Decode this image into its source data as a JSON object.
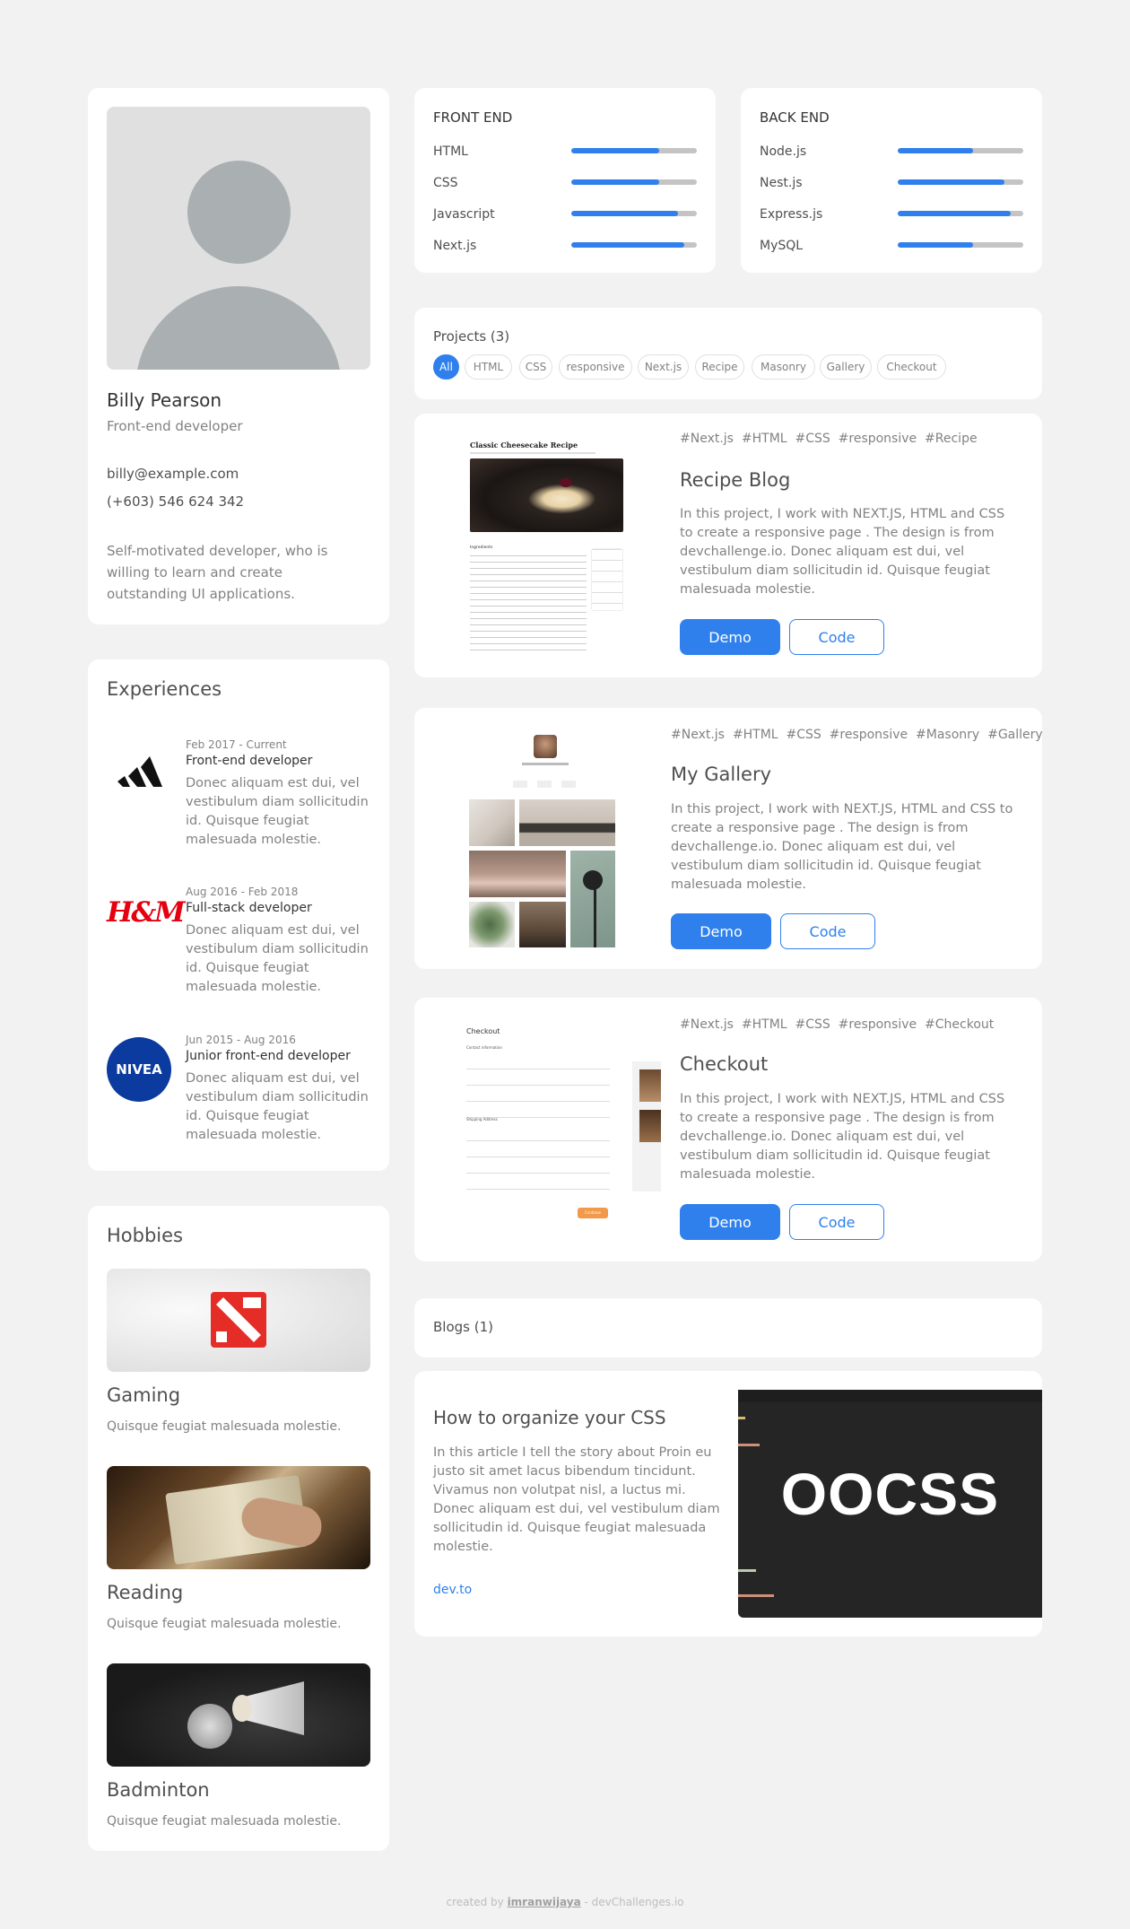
{
  "profile": {
    "name": "Billy Pearson",
    "title": "Front-end developer",
    "email": "billy@example.com",
    "phone": "(+603) 546 624 342",
    "bio": "Self-motivated developer, who is willing to learn and create outstanding UI applications."
  },
  "skills": {
    "front": {
      "heading": "FRONT END",
      "items": [
        {
          "name": "HTML",
          "level": 0.7
        },
        {
          "name": "CSS",
          "level": 0.7
        },
        {
          "name": "Javascript",
          "level": 0.85
        },
        {
          "name": "Next.js",
          "level": 0.9
        }
      ]
    },
    "back": {
      "heading": "BACK END",
      "items": [
        {
          "name": "Node.js",
          "level": 0.6
        },
        {
          "name": "Nest.js",
          "level": 0.85
        },
        {
          "name": "Express.js",
          "level": 0.9
        },
        {
          "name": "MySQL",
          "level": 0.6
        }
      ]
    }
  },
  "projects_header": {
    "title": "Projects (3)",
    "filters": [
      "All",
      "HTML",
      "CSS",
      "responsive",
      "Next.js",
      "Recipe",
      "Masonry",
      "Gallery",
      "Checkout"
    ],
    "active": "All"
  },
  "projects": [
    {
      "tags": "#Next.js  #HTML  #CSS  #responsive  #Recipe",
      "title": "Recipe Blog",
      "desc": "In this project, I work with NEXT.JS, HTML and CSS to create a responsive page . The design is from devchallenge.io. Donec aliquam est dui, vel vestibulum diam sollicitudin id. Quisque feugiat malesuada molestie.",
      "demo": "Demo",
      "code": "Code",
      "thumb_title": "Classic Cheesecake Recipe",
      "thumb_section": "Ingredients"
    },
    {
      "tags": "#Next.js  #HTML  #CSS  #responsive  #Masonry  #Gallery",
      "title": "My Gallery",
      "desc": "In this project, I work with NEXT.JS, HTML and CSS to create a responsive page . The design is from devchallenge.io. Donec aliquam est dui, vel vestibulum diam sollicitudin id. Quisque feugiat malesuada molestie.",
      "demo": "Demo",
      "code": "Code"
    },
    {
      "tags": "#Next.js  #HTML  #CSS  #responsive  #Checkout",
      "title": "Checkout",
      "desc": "In this project, I work with NEXT.JS, HTML and CSS to create a responsive page . The design is from devchallenge.io. Donec aliquam est dui, vel vestibulum diam sollicitudin id. Quisque feugiat malesuada molestie.",
      "demo": "Demo",
      "code": "Code",
      "thumb_title": "Checkout",
      "thumb_sections": [
        "Contact information",
        "Shipping Address"
      ],
      "thumb_button": "Continue"
    }
  ],
  "experiences": {
    "title": "Experiences",
    "items": [
      {
        "date": "Feb 2017 - Current",
        "role": "Front-end developer",
        "desc": "Donec aliquam est dui, vel vestibulum diam sollicitudin id. Quisque feugiat malesuada molestie.",
        "logo": "adidas-logo"
      },
      {
        "date": "Aug 2016 - Feb 2018",
        "role": "Full-stack developer",
        "desc": "Donec aliquam est dui, vel vestibulum diam sollicitudin id. Quisque feugiat malesuada molestie.",
        "logo": "hm-logo",
        "logo_text": "H&M"
      },
      {
        "date": "Jun 2015 - Aug 2016",
        "role": "Junior front-end developer",
        "desc": "Donec aliquam est dui, vel vestibulum diam sollicitudin id. Quisque feugiat malesuada molestie.",
        "logo": "nivea-logo",
        "logo_text": "NIVEA"
      }
    ]
  },
  "hobbies": {
    "title": "Hobbies",
    "items": [
      {
        "name": "Gaming",
        "desc": "Quisque feugiat malesuada molestie."
      },
      {
        "name": "Reading",
        "desc": "Quisque feugiat malesuada molestie."
      },
      {
        "name": "Badminton",
        "desc": "Quisque feugiat malesuada molestie."
      }
    ]
  },
  "blogs": {
    "header": "Blogs (1)",
    "post": {
      "title": "How to organize your CSS",
      "desc": "In this article I tell the story about Proin eu justo sit amet lacus bibendum tincidunt. Vivamus non volutpat nisl, a luctus mi. Donec aliquam est dui, vel vestibulum diam sollicitudin id. Quisque feugiat malesuada molestie.",
      "link": "dev.to",
      "image_text": "OOCSS"
    }
  },
  "footer": {
    "prefix": "created by ",
    "author": "imranwijaya",
    "suffix": " - devChallenges.io"
  },
  "colors": {
    "accent": "#2f80ed",
    "background": "#f2f2f2",
    "card": "#ffffff",
    "muted": "#828282"
  }
}
